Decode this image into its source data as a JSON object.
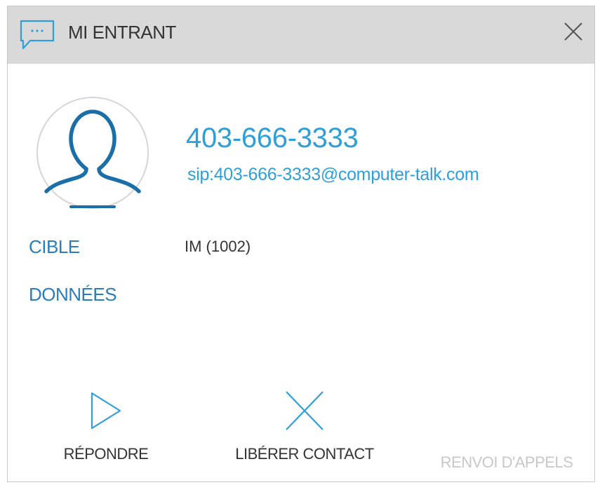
{
  "titlebar": {
    "title": "MI ENTRANT",
    "icon": "chat-bubble-icon",
    "close_icon": "close-icon"
  },
  "contact": {
    "avatar_icon": "user-avatar-icon",
    "phone": "403-666-3333",
    "sip": "sip:403-666-3333@computer-talk.com"
  },
  "details": {
    "target_label": "CIBLE",
    "target_value": "IM (1002)",
    "data_label": "DONNÉES"
  },
  "actions": {
    "answer": {
      "label": "RÉPONDRE",
      "icon": "play-icon",
      "enabled": true
    },
    "release": {
      "label": "LIBÉRER CONTACT",
      "icon": "close-icon",
      "enabled": true
    },
    "forward": {
      "label": "RENVOI D'APPELS",
      "enabled": false
    }
  },
  "colors": {
    "accent": "#2e9fd8",
    "label_blue": "#2a7db8",
    "titlebar_bg": "#d9d9d9",
    "icon_dark_blue": "#1b6fa8",
    "disabled_text": "#c8c8c8"
  }
}
